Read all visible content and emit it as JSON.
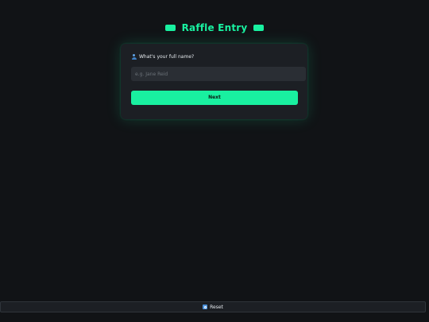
{
  "header": {
    "title": "Raffle Entry",
    "icon": "ticket-icon"
  },
  "form": {
    "question": "What's your full name?",
    "question_icon": "person-icon",
    "name_input": {
      "value": "",
      "placeholder": "e.g. Jane Reid"
    },
    "next_label": "Next"
  },
  "footer": {
    "reset_label": "Reset",
    "reset_icon": "reset-icon"
  },
  "colors": {
    "accent": "#19f0a0",
    "background": "#111316",
    "card": "#1c1f24",
    "input": "#2a2e34"
  }
}
